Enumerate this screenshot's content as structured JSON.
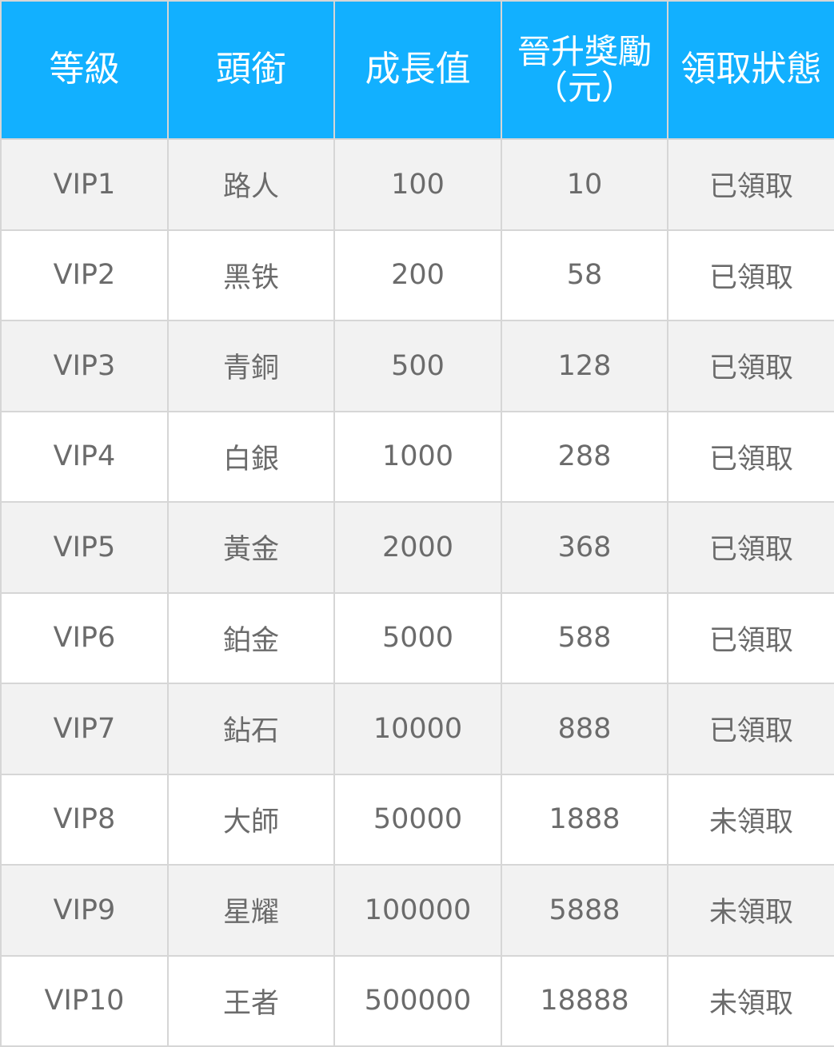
{
  "table": {
    "headers": {
      "level": "等級",
      "title": "頭銜",
      "growth": "成長值",
      "reward_line1": "晉升獎勵",
      "reward_line2": "（元）",
      "status": "領取狀態"
    },
    "rows": [
      {
        "level": "VIP1",
        "title": "路人",
        "growth": "100",
        "reward": "10",
        "status": "已領取"
      },
      {
        "level": "VIP2",
        "title": "黑铁",
        "growth": "200",
        "reward": "58",
        "status": "已領取"
      },
      {
        "level": "VIP3",
        "title": "青銅",
        "growth": "500",
        "reward": "128",
        "status": "已領取"
      },
      {
        "level": "VIP4",
        "title": "白銀",
        "growth": "1000",
        "reward": "288",
        "status": "已領取"
      },
      {
        "level": "VIP5",
        "title": "黃金",
        "growth": "2000",
        "reward": "368",
        "status": "已領取"
      },
      {
        "level": "VIP6",
        "title": "鉑金",
        "growth": "5000",
        "reward": "588",
        "status": "已領取"
      },
      {
        "level": "VIP7",
        "title": "鉆石",
        "growth": "10000",
        "reward": "888",
        "status": "已領取"
      },
      {
        "level": "VIP8",
        "title": "大師",
        "growth": "50000",
        "reward": "1888",
        "status": "未領取"
      },
      {
        "level": "VIP9",
        "title": "星耀",
        "growth": "100000",
        "reward": "5888",
        "status": "未領取"
      },
      {
        "level": "VIP10",
        "title": "王者",
        "growth": "500000",
        "reward": "18888",
        "status": "未領取"
      }
    ]
  },
  "colors": {
    "header_bg": "#12b0ff",
    "header_text": "#ffffff",
    "row_odd_bg": "#f2f2f2",
    "row_even_bg": "#ffffff",
    "cell_text": "#6b6b6b",
    "border": "#d6d6d6"
  }
}
